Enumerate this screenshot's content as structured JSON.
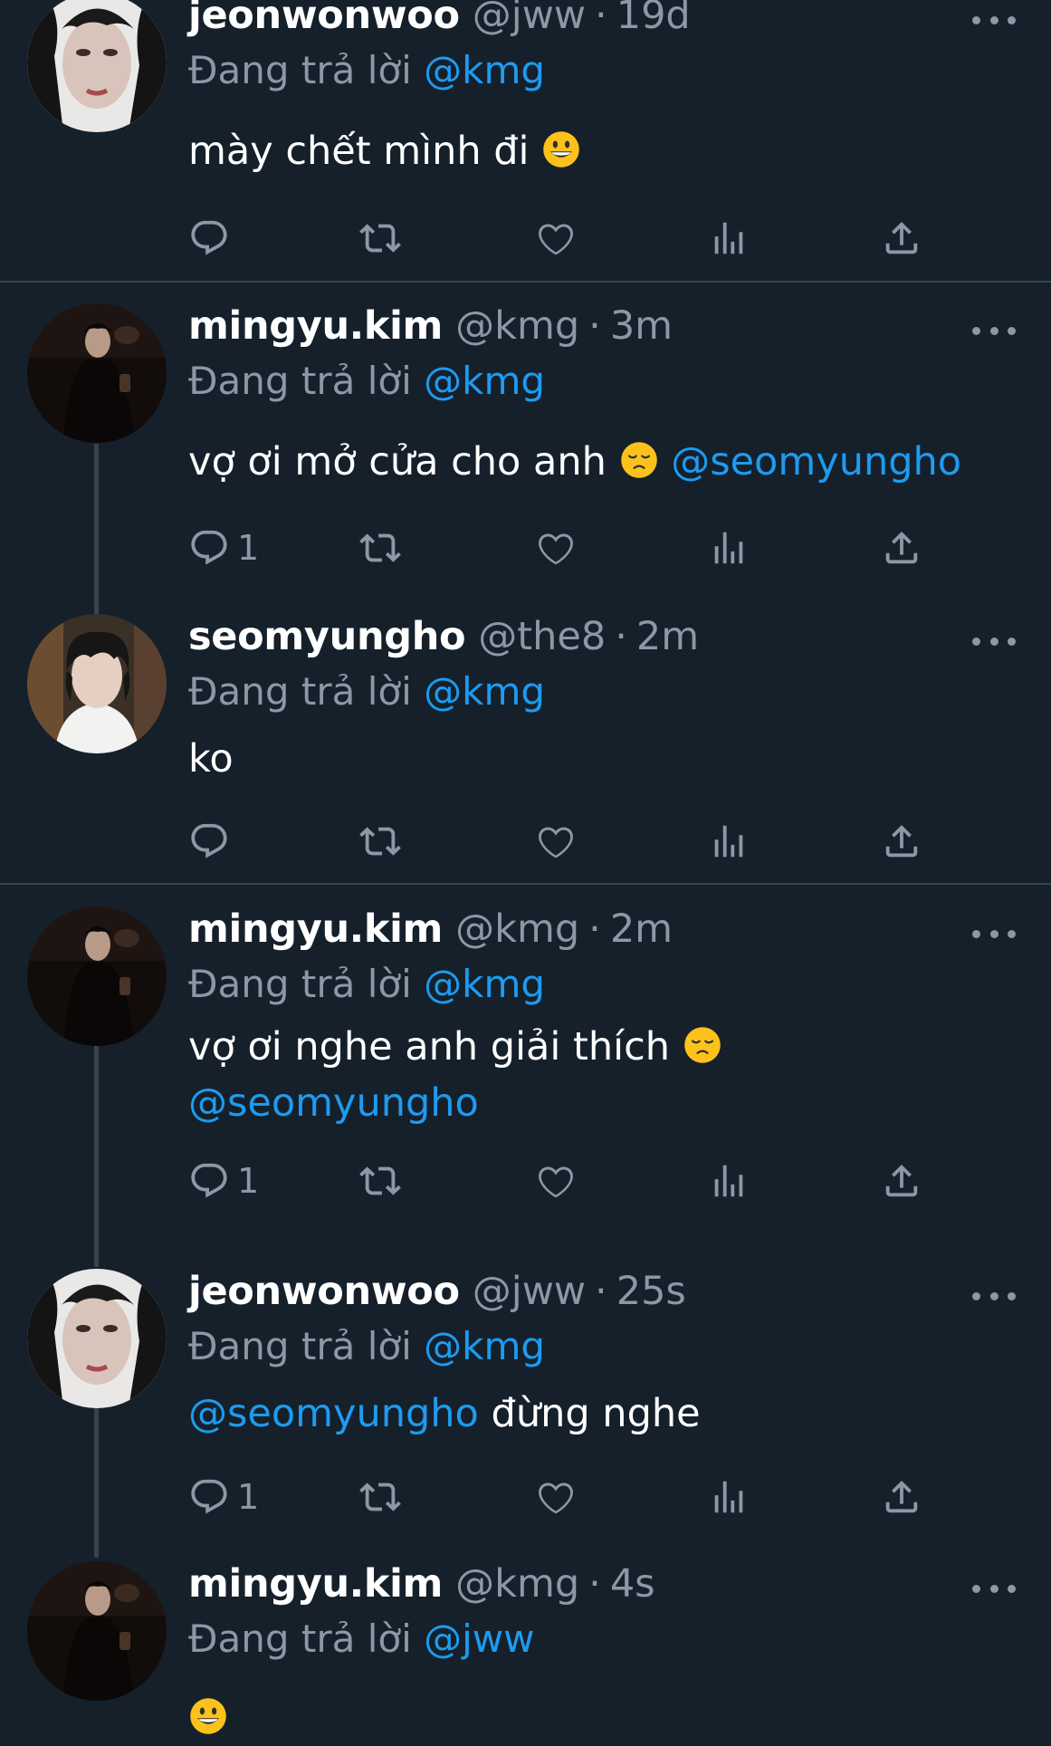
{
  "reply_prefix": "Đang trả lời",
  "tweets": [
    {
      "name": "jeonwonwoo",
      "handle": "@jww",
      "sep": "·",
      "time": "19d",
      "reply_to": "@kmg",
      "text": "mày chết mình đi",
      "emoji": "grinning-face",
      "reply_count": ""
    },
    {
      "name": "mingyu.kim",
      "handle": "@kmg",
      "sep": "·",
      "time": "3m",
      "reply_to": "@kmg",
      "text": "vợ ơi mở cửa cho anh",
      "emoji": "disappointed-face",
      "mention": "@seomyungho",
      "reply_count": "1"
    },
    {
      "name": "seomyungho",
      "handle": "@the8",
      "sep": "·",
      "time": "2m",
      "reply_to": "@kmg",
      "text": "ko",
      "reply_count": ""
    },
    {
      "name": "mingyu.kim",
      "handle": "@kmg",
      "sep": "·",
      "time": "2m",
      "reply_to": "@kmg",
      "text": "vợ ơi nghe anh giải thích",
      "emoji": "disappointed-face",
      "mention": "@seomyungho",
      "reply_count": "1"
    },
    {
      "name": "jeonwonwoo",
      "handle": "@jww",
      "sep": "·",
      "time": "25s",
      "reply_to": "@kmg",
      "mention": "@seomyungho",
      "text": "đừng nghe",
      "reply_count": "1"
    },
    {
      "name": "mingyu.kim",
      "handle": "@kmg",
      "sep": "·",
      "time": "4s",
      "reply_to": "@jww",
      "emoji": "grinning-face"
    }
  ],
  "icons": {
    "reply": "reply-icon",
    "retweet": "retweet-icon",
    "like": "heart-icon",
    "views": "views-icon",
    "share": "share-icon",
    "more": "more-icon"
  },
  "colors": {
    "background": "#15202b",
    "text": "#ffffff",
    "secondary": "#8b98a5",
    "accent": "#1d9bf0",
    "divider": "#38444d"
  }
}
